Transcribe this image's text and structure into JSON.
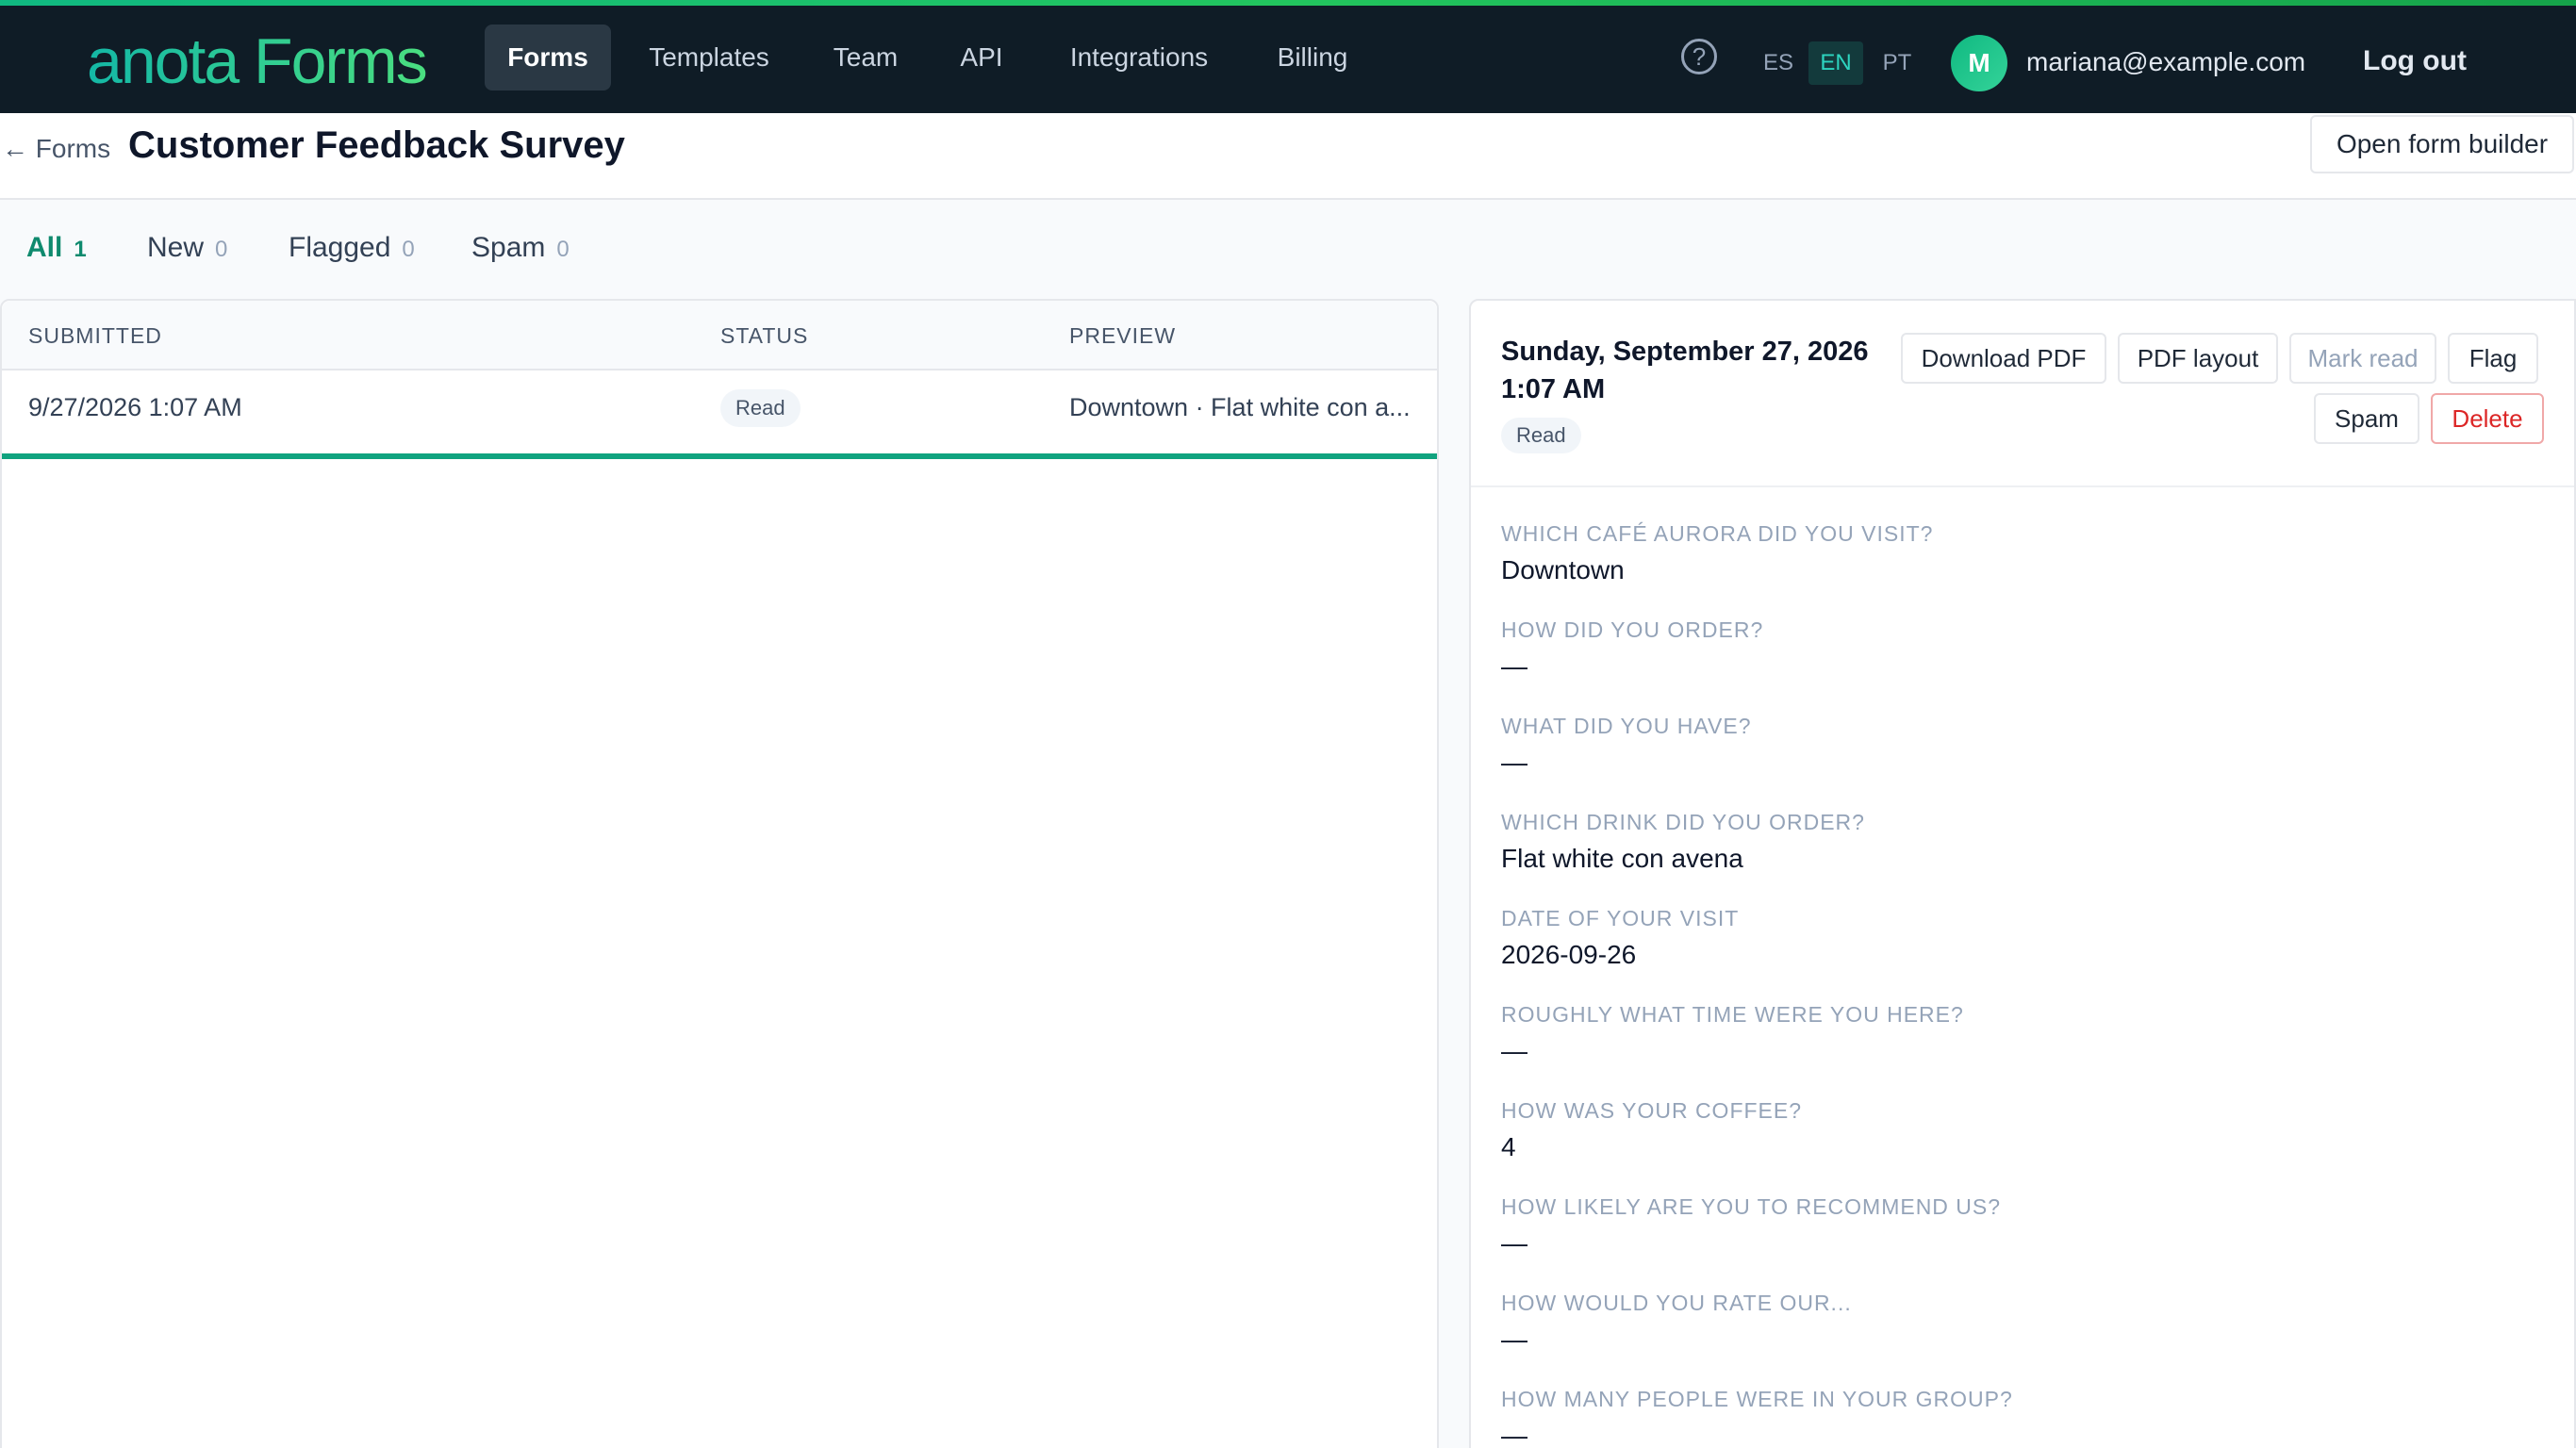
{
  "brand": {
    "name": "anota Forms"
  },
  "nav": {
    "items": [
      {
        "label": "Forms",
        "active": true
      },
      {
        "label": "Templates",
        "active": false
      },
      {
        "label": "Team",
        "active": false
      },
      {
        "label": "API",
        "active": false
      },
      {
        "label": "Integrations",
        "active": false
      },
      {
        "label": "Billing",
        "active": false
      }
    ]
  },
  "header_right": {
    "help_glyph": "?",
    "languages": [
      {
        "code": "ES",
        "active": false
      },
      {
        "code": "EN",
        "active": true
      },
      {
        "code": "PT",
        "active": false
      }
    ],
    "avatar_initial": "M",
    "email": "mariana@example.com",
    "logout_label": "Log out"
  },
  "page": {
    "back_label": "← Forms",
    "title": "Customer Feedback Survey",
    "open_builder_label": "Open form builder"
  },
  "tabs": [
    {
      "label": "All",
      "count": "1",
      "active": true
    },
    {
      "label": "New",
      "count": "0",
      "active": false
    },
    {
      "label": "Flagged",
      "count": "0",
      "active": false
    },
    {
      "label": "Spam",
      "count": "0",
      "active": false
    }
  ],
  "table": {
    "columns": [
      "SUBMITTED",
      "STATUS",
      "PREVIEW"
    ],
    "rows": [
      {
        "submitted": "9/27/2026 1:07 AM",
        "status": "Read",
        "preview": "Downtown · Flat white con a...",
        "selected": true
      }
    ]
  },
  "detail": {
    "date_line1": "Sunday, September 27, 2026",
    "date_line2": "1:07 AM",
    "status": "Read",
    "actions": {
      "download_pdf": "Download PDF",
      "pdf_layout": "PDF layout",
      "mark_read": "Mark read",
      "flag": "Flag",
      "spam": "Spam",
      "delete": "Delete"
    },
    "fields": [
      {
        "label": "WHICH CAFÉ AURORA DID YOU VISIT?",
        "value": "Downtown"
      },
      {
        "label": "HOW DID YOU ORDER?",
        "value": "—"
      },
      {
        "label": "WHAT DID YOU HAVE?",
        "value": "—"
      },
      {
        "label": "WHICH DRINK DID YOU ORDER?",
        "value": "Flat white con avena"
      },
      {
        "label": "DATE OF YOUR VISIT",
        "value": "2026-09-26"
      },
      {
        "label": "ROUGHLY WHAT TIME WERE YOU HERE?",
        "value": "—"
      },
      {
        "label": "HOW WAS YOUR COFFEE?",
        "value": "4"
      },
      {
        "label": "HOW LIKELY ARE YOU TO RECOMMEND US?",
        "value": "—"
      },
      {
        "label": "HOW WOULD YOU RATE OUR...",
        "value": "—"
      },
      {
        "label": "HOW MANY PEOPLE WERE IN YOUR GROUP?",
        "value": "—"
      }
    ]
  },
  "colors": {
    "topbar": "#0f1c26",
    "accent": "#10a37f",
    "danger": "#dc2626"
  }
}
